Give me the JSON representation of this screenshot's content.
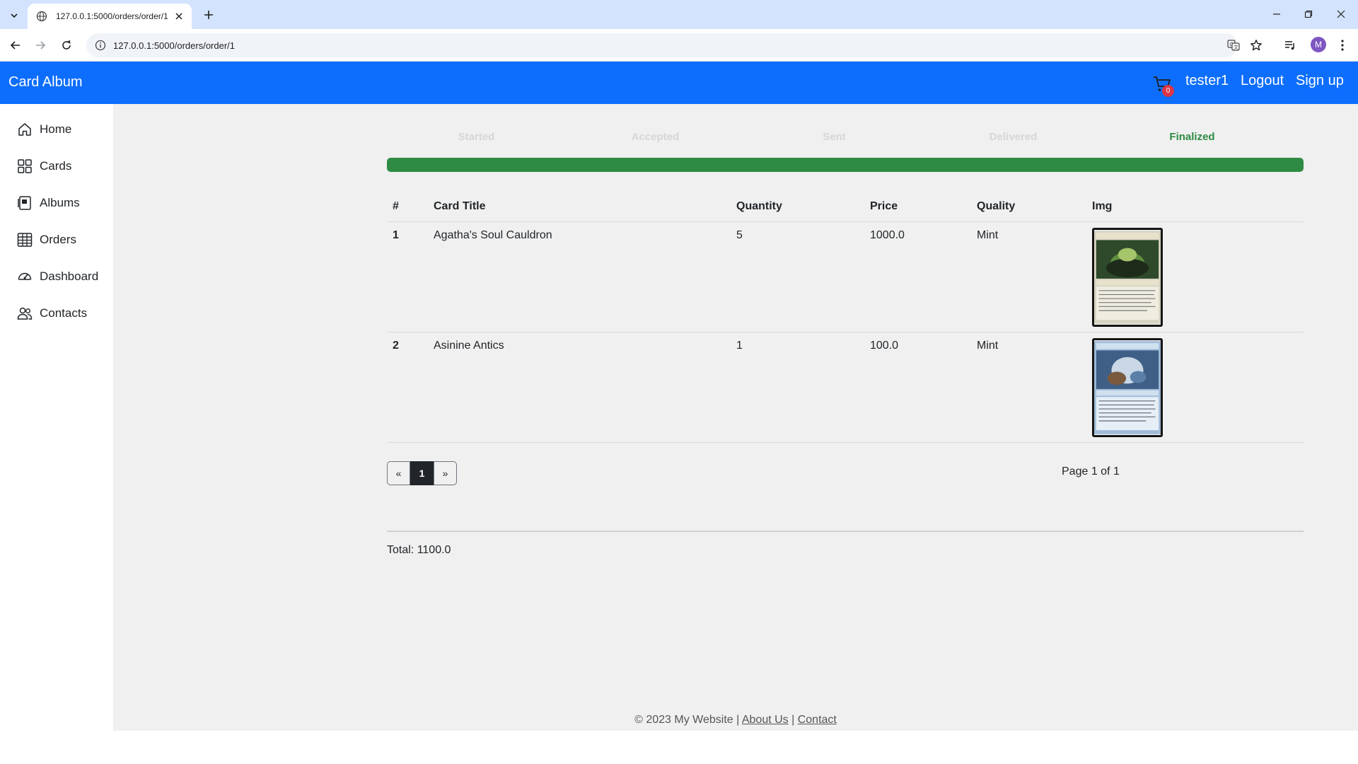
{
  "browser": {
    "tab_title": "127.0.0.1:5000/orders/order/1",
    "url": "127.0.0.1:5000/orders/order/1",
    "profile_initial": "M"
  },
  "navbar": {
    "brand": "Card Album",
    "cart_count": "0",
    "username": "tester1",
    "logout": "Logout",
    "signup": "Sign up",
    "color": "#0d6efd"
  },
  "sidebar": {
    "items": [
      {
        "label": "Home",
        "icon": "house-icon"
      },
      {
        "label": "Cards",
        "icon": "grid-icon"
      },
      {
        "label": "Albums",
        "icon": "album-icon"
      },
      {
        "label": "Orders",
        "icon": "table-icon"
      },
      {
        "label": "Dashboard",
        "icon": "speedometer-icon"
      },
      {
        "label": "Contacts",
        "icon": "people-icon"
      }
    ]
  },
  "order": {
    "steps": [
      "Started",
      "Accepted",
      "Sent",
      "Delivered",
      "Finalized"
    ],
    "active_step": "Finalized",
    "progress_percent": 100,
    "progress_color": "#2e8b43",
    "columns": [
      "#",
      "Card Title",
      "Quantity",
      "Price",
      "Quality",
      "Img"
    ],
    "rows": [
      {
        "num": "1",
        "title": "Agatha's Soul Cauldron",
        "quantity": "5",
        "price": "1000.0",
        "quality": "Mint"
      },
      {
        "num": "2",
        "title": "Asinine Antics",
        "quantity": "1",
        "price": "100.0",
        "quality": "Mint"
      }
    ],
    "pagination": {
      "prev": "«",
      "current": "1",
      "next": "»",
      "info": "Page 1 of 1"
    },
    "total": "Total: 1100.0"
  },
  "footer": {
    "copyright": "© 2023 My Website |",
    "separator": "|",
    "about": "About Us",
    "contact": "Contact"
  }
}
